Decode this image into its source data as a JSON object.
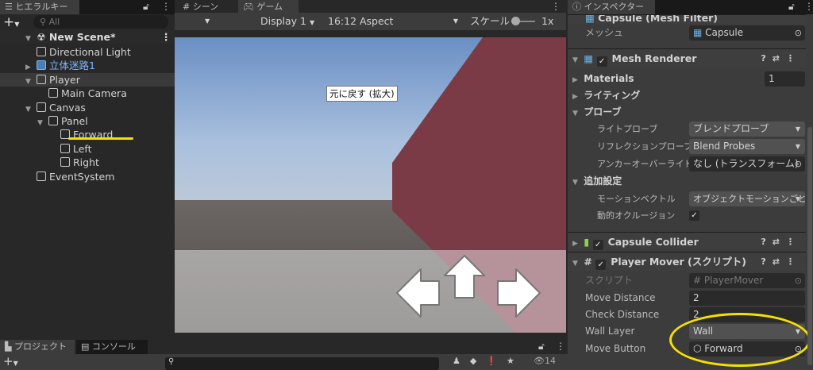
{
  "hierarchy": {
    "tab": "ヒエラルキー",
    "search_placeholder": "All",
    "scene": "New Scene*",
    "items": [
      {
        "label": "Directional Light",
        "depth": 1,
        "arrow": ""
      },
      {
        "label": "立体迷路1",
        "depth": 1,
        "arrow": "▶",
        "prefab": true
      },
      {
        "label": "Player",
        "depth": 1,
        "arrow": "▼",
        "selected": true
      },
      {
        "label": "Main Camera",
        "depth": 2,
        "arrow": ""
      },
      {
        "label": "Canvas",
        "depth": 1,
        "arrow": "▼"
      },
      {
        "label": "Panel",
        "depth": 2,
        "arrow": "▼"
      },
      {
        "label": "Forward",
        "depth": 3,
        "arrow": "",
        "highlighted": true
      },
      {
        "label": "Left",
        "depth": 3,
        "arrow": ""
      },
      {
        "label": "Right",
        "depth": 3,
        "arrow": ""
      },
      {
        "label": "EventSystem",
        "depth": 1,
        "arrow": ""
      }
    ]
  },
  "game": {
    "tab_scene": "シーン",
    "tab_game": "ゲーム",
    "display": "Display 1",
    "aspect": "16:12 Aspect",
    "scale_label": "スケール",
    "scale_value": "1x",
    "tooltip": "元に戻す (拡大)"
  },
  "inspector": {
    "tab": "インスペクター",
    "mesh_filter": {
      "title": "Capsule (Mesh Filter)",
      "mesh_label": "メッシュ",
      "mesh_value": "Capsule"
    },
    "mesh_renderer": {
      "title": "Mesh Renderer",
      "materials": "Materials",
      "materials_count": "1",
      "lighting": "ライティング",
      "probes": "プローブ",
      "light_probe_label": "ライトプローブ",
      "light_probe_value": "ブレンドプローブ",
      "reflection_label": "リフレクションプローブ",
      "reflection_value": "Blend Probes",
      "anchor_label": "アンカーオーバーライド",
      "anchor_value": "なし (トランスフォーム)",
      "additional": "追加設定",
      "motion_label": "モーションベクトル",
      "motion_value": "オブジェクトモーションごと",
      "occlusion_label": "動的オクルージョン"
    },
    "capsule_collider": {
      "title": "Capsule Collider"
    },
    "player_mover": {
      "title": "Player Mover (スクリプト)",
      "script_label": "スクリプト",
      "script_value": "PlayerMover",
      "move_distance_label": "Move Distance",
      "move_distance": "2",
      "check_distance_label": "Check Distance",
      "check_distance": "2",
      "wall_layer_label": "Wall Layer",
      "wall_layer": "Wall",
      "move_button_label": "Move Button",
      "move_button": "Forward"
    }
  },
  "bottom": {
    "tab_project": "プロジェクト",
    "tab_console": "コンソール",
    "hidden_count": "14"
  },
  "colors": {
    "highlight": "#f5e100",
    "wall": "#7a3b47",
    "prefab": "#7cb7ff"
  }
}
